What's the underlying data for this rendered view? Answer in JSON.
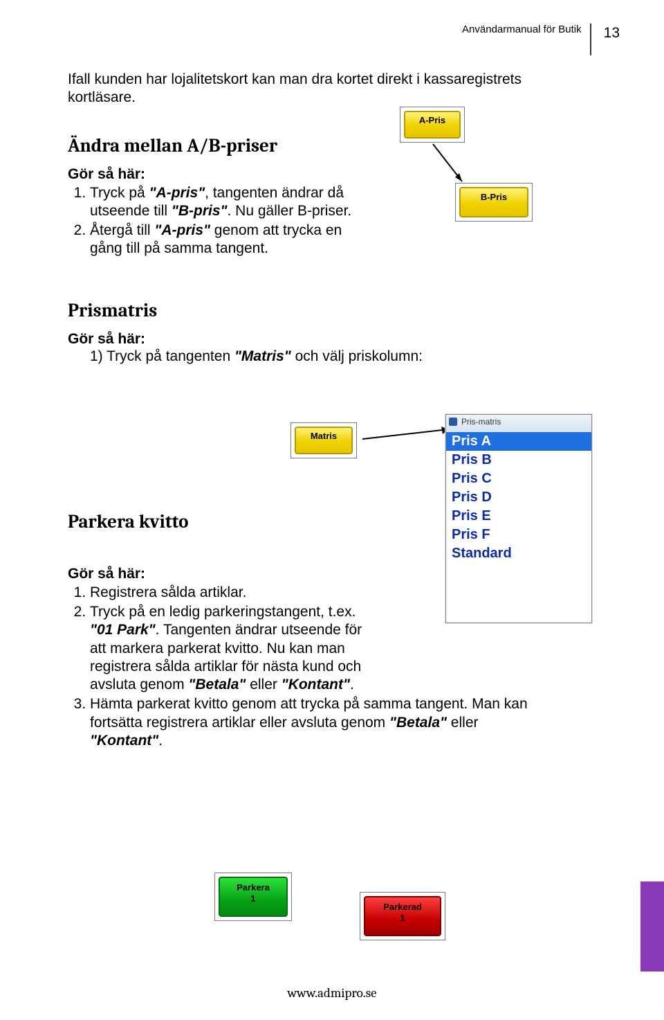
{
  "header": {
    "manual_title": "Användarmanual för Butik",
    "page_number": "13"
  },
  "intro_text": "Ifall kunden har lojalitetskort kan man dra kortet direkt i kassaregistrets kortläsare.",
  "section_ab": {
    "heading": "Ändra mellan A/B-priser",
    "steps_label": "Gör så här:",
    "step1_a": "Tryck på ",
    "step1_b": "\"A-pris\"",
    "step1_c": ", tangenten ändrar då utseende till ",
    "step1_d": "\"B-pris\"",
    "step1_e": ". Nu gäller B-priser.",
    "step2_a": "Återgå till ",
    "step2_b": "\"A-pris\"",
    "step2_c": " genom att trycka en gång till på samma tangent.",
    "btn_a": "A-Pris",
    "btn_b": "B-Pris"
  },
  "section_prism": {
    "heading": "Prismatris",
    "steps_label": "Gör så här:",
    "step1_a": "1) Tryck på tangenten ",
    "step1_b": "\"Matris\"",
    "step1_c": " och välj priskolumn:",
    "btn_matris": "Matris",
    "popup_title": "Pris-matris",
    "options": [
      "Pris A",
      "Pris B",
      "Pris C",
      "Pris D",
      "Pris E",
      "Pris F",
      "Standard"
    ]
  },
  "section_park": {
    "heading": "Parkera kvitto",
    "steps_label": "Gör så här:",
    "step1": "Registrera sålda artiklar.",
    "step2_a": "Tryck på en ledig parkeringstangent, t.ex. ",
    "step2_b": "\"01 Park\"",
    "step2_c": ". Tangenten ändrar utseende för att markera parkerat kvitto. Nu kan man registrera sålda artiklar för nästa kund och avsluta genom ",
    "step2_d": "\"Betala\"",
    "step2_e": " eller ",
    "step2_f": "\"Kontant\"",
    "step2_g": ".",
    "step3_a": "Hämta parkerat kvitto genom att trycka på samma tangent. Man kan fortsätta registrera artiklar eller avsluta genom ",
    "step3_b": "\"Betala\"",
    "step3_c": " eller ",
    "step3_d": "\"Kontant\"",
    "step3_e": ".",
    "btn_parkera_line1": "Parkera",
    "btn_parkera_line2": "1",
    "btn_parkerad_line1": "Parkerad",
    "btn_parkerad_line2": "1"
  },
  "footer": "www.admipro.se"
}
